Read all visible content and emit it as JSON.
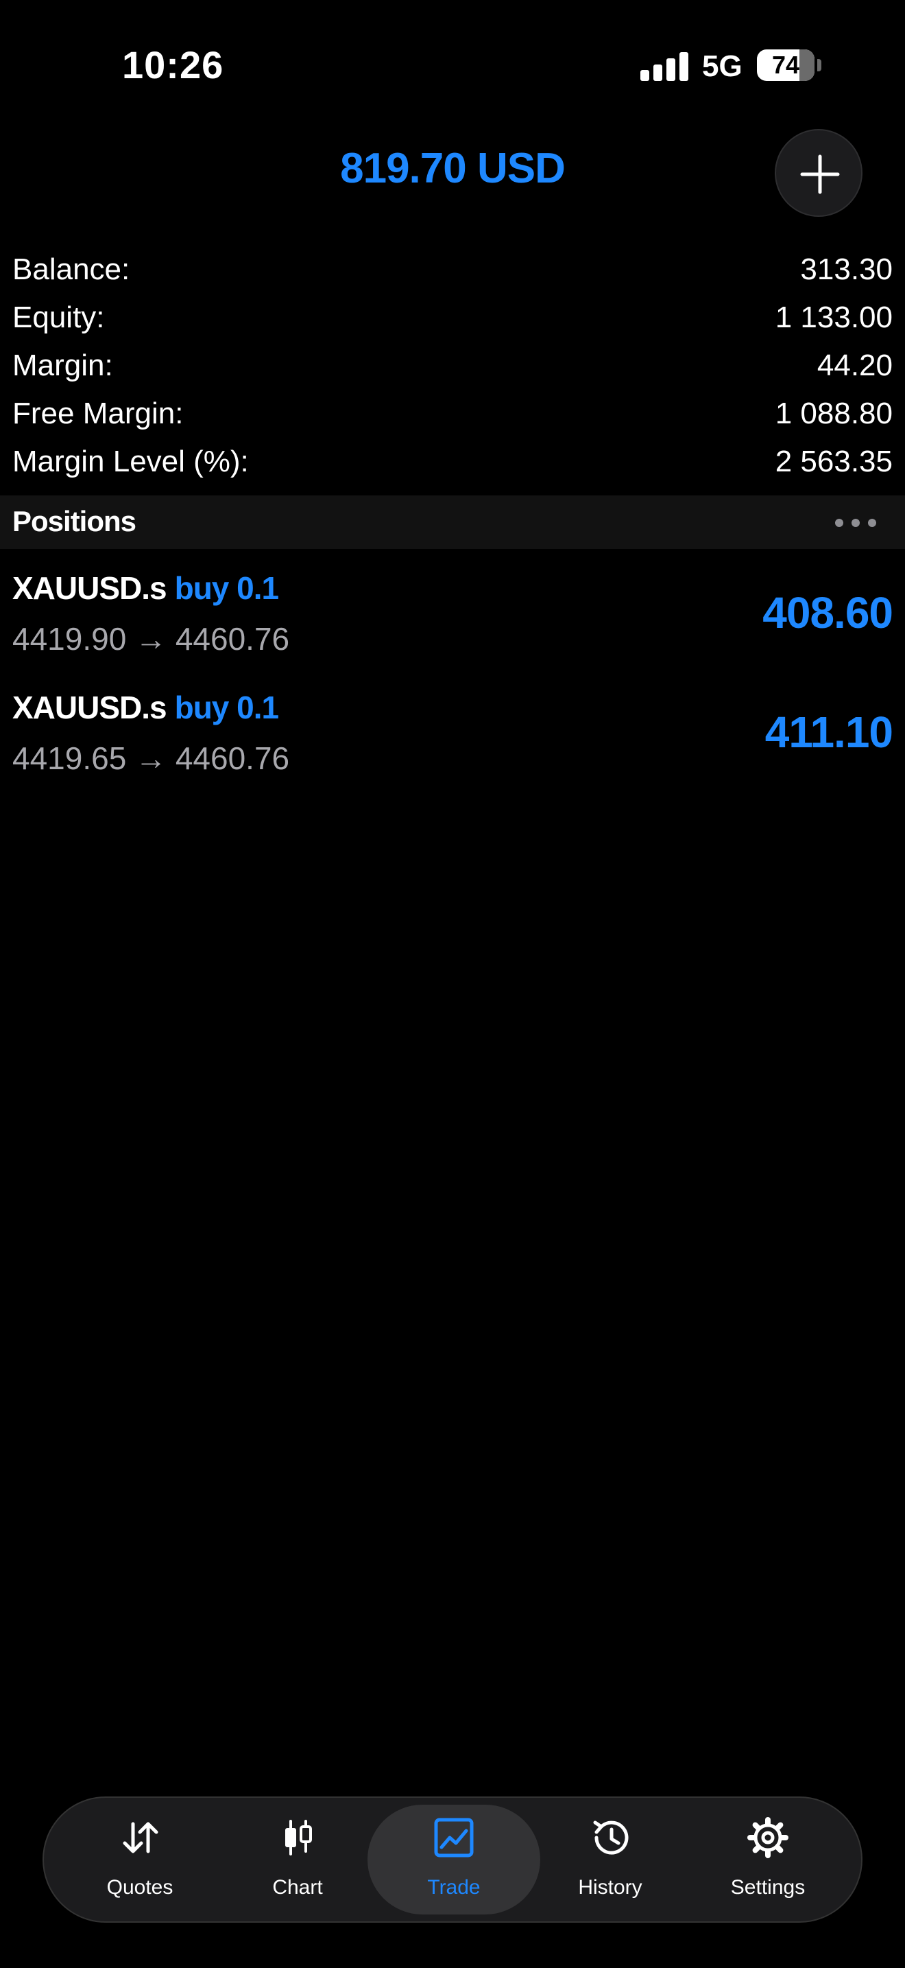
{
  "status_bar": {
    "time": "10:26",
    "network": "5G",
    "battery": "74",
    "battery_level": 0.74
  },
  "header": {
    "title": "819.70 USD",
    "add_icon": "plus-icon"
  },
  "account": [
    {
      "label": "Balance:",
      "value": "313.30"
    },
    {
      "label": "Equity:",
      "value": "1 133.00"
    },
    {
      "label": "Margin:",
      "value": "44.20"
    },
    {
      "label": "Free Margin:",
      "value": "1 088.80"
    },
    {
      "label": "Margin Level (%):",
      "value": "2 563.35"
    }
  ],
  "positions": {
    "title": "Positions",
    "menu_icon": "more-icon",
    "items": [
      {
        "symbol": "XAUUSD.s",
        "side": "buy 0.1",
        "open": "4419.90",
        "arrow": "→",
        "current": "4460.76",
        "profit": "408.60"
      },
      {
        "symbol": "XAUUSD.s",
        "side": "buy 0.1",
        "open": "4419.65",
        "arrow": "→",
        "current": "4460.76",
        "profit": "411.10"
      }
    ]
  },
  "tab_bar": {
    "tabs": [
      {
        "label": "Quotes",
        "icon": "quotes-arrows-icon"
      },
      {
        "label": "Chart",
        "icon": "candlestick-icon"
      },
      {
        "label": "Trade",
        "icon": "trade-chart-icon",
        "active": true
      },
      {
        "label": "History",
        "icon": "history-clock-icon"
      },
      {
        "label": "Settings",
        "icon": "gear-icon"
      }
    ]
  },
  "colors": {
    "accent": "#1e88ff",
    "background": "#000000",
    "secondary_text": "#a8a8ad"
  }
}
